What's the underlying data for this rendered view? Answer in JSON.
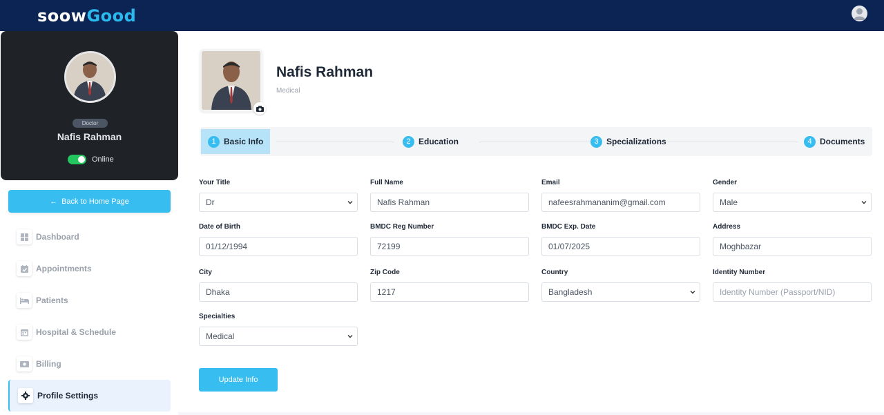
{
  "header": {
    "logo_part1": "soow",
    "logo_part2": "Good"
  },
  "sidebar": {
    "role": "Doctor",
    "name": "Nafis Rahman",
    "status": "Online",
    "back_label": "Back to Home Page",
    "items": [
      {
        "label": "Dashboard",
        "icon": "grid-icon"
      },
      {
        "label": "Appointments",
        "icon": "calendar-check-icon"
      },
      {
        "label": "Patients",
        "icon": "bed-icon"
      },
      {
        "label": "Hospital & Schedule",
        "icon": "calendar-icon"
      },
      {
        "label": "Billing",
        "icon": "money-icon"
      },
      {
        "label": "Profile Settings",
        "icon": "gear-icon"
      }
    ]
  },
  "profile": {
    "name": "Nafis Rahman",
    "specialty": "Medical"
  },
  "steps": [
    {
      "num": "1",
      "label": "Basic Info"
    },
    {
      "num": "2",
      "label": "Education"
    },
    {
      "num": "3",
      "label": "Specializations"
    },
    {
      "num": "4",
      "label": "Documents"
    }
  ],
  "form": {
    "title": {
      "label": "Your Title",
      "value": "Dr"
    },
    "full_name": {
      "label": "Full Name",
      "value": "Nafis Rahman"
    },
    "email": {
      "label": "Email",
      "value": "nafeesrahmananim@gmail.com"
    },
    "gender": {
      "label": "Gender",
      "value": "Male"
    },
    "dob": {
      "label": "Date of Birth",
      "value": "01/12/1994"
    },
    "bmdc_reg": {
      "label": "BMDC Reg Number",
      "value": "72199"
    },
    "bmdc_exp": {
      "label": "BMDC Exp. Date",
      "value": "01/07/2025"
    },
    "address": {
      "label": "Address",
      "value": "Moghbazar"
    },
    "city": {
      "label": "City",
      "value": "Dhaka"
    },
    "zip": {
      "label": "Zip Code",
      "value": "1217"
    },
    "country": {
      "label": "Country",
      "value": "Bangladesh"
    },
    "identity": {
      "label": "Identity Number",
      "placeholder": "Identity Number (Passport/NID)"
    },
    "specialties": {
      "label": "Specialties",
      "value": "Medical"
    },
    "update_label": "Update Info"
  }
}
